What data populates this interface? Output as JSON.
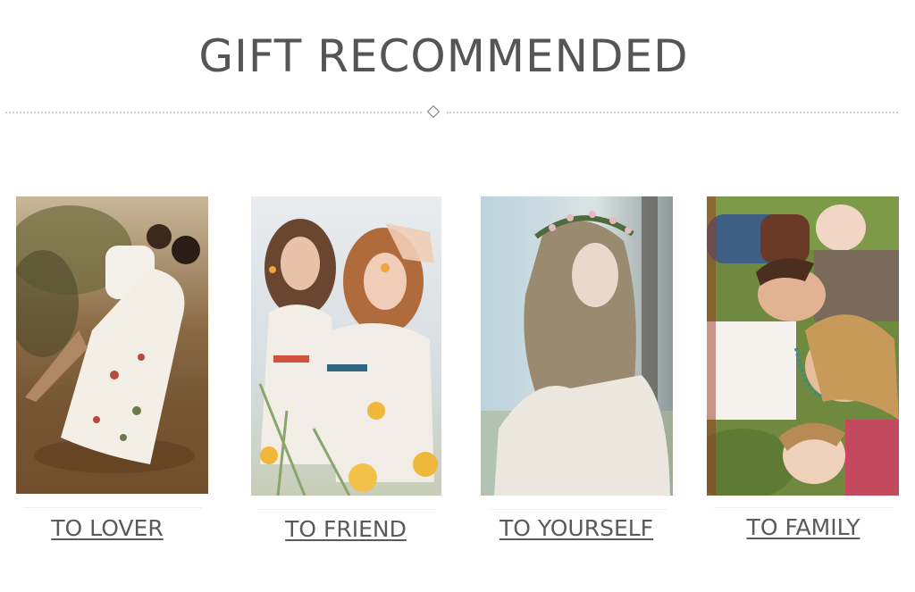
{
  "section": {
    "title": "GIFT RECOMMENDED"
  },
  "cards": [
    {
      "label": "TO LOVER",
      "image_subject": "couple-on-beach-photo"
    },
    {
      "label": "TO FRIEND",
      "image_subject": "two-women-with-flowers-photo"
    },
    {
      "label": "TO YOURSELF",
      "image_subject": "woman-with-flower-crown-photo"
    },
    {
      "label": "TO FAMILY",
      "image_subject": "family-lying-on-grass-photo"
    }
  ],
  "colors": {
    "title": "#555555",
    "link": "#5a5a5a",
    "divider": "#cfcfcf",
    "background": "#ffffff"
  }
}
